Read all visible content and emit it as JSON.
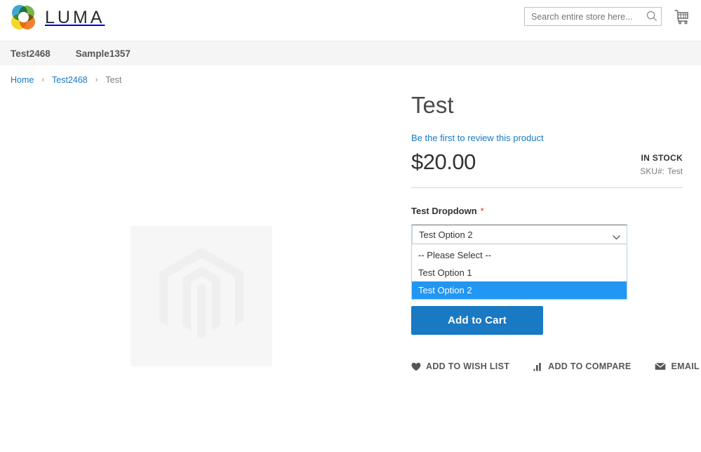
{
  "header": {
    "logo_text": "LUMA",
    "logo_icon": "luma-ring-logo",
    "search": {
      "placeholder": "Search entire store here...",
      "value": "",
      "icon": "search-icon"
    },
    "cart": {
      "icon": "shopping-cart-icon"
    }
  },
  "nav": {
    "items": [
      {
        "label": "Test2468"
      },
      {
        "label": "Sample1357"
      }
    ]
  },
  "breadcrumbs": {
    "separator": "›",
    "items": [
      {
        "label": "Home",
        "current": false
      },
      {
        "label": "Test2468",
        "current": false
      },
      {
        "label": "Test",
        "current": true
      }
    ]
  },
  "product": {
    "media": {
      "placeholder_icon": "magento-hexagon-placeholder"
    },
    "title": "Test",
    "review_link": "Be the first to review this product",
    "price": "$20.00",
    "stock_status": "IN STOCK",
    "sku_label": "SKU#:",
    "sku_value": "Test",
    "option": {
      "label": "Test Dropdown",
      "required_mark": "*",
      "selected_value": "Test Option 2",
      "chevron_icon": "chevron-down-icon",
      "options": [
        {
          "label": "-- Please Select --",
          "selected": false
        },
        {
          "label": "Test Option 1",
          "selected": false
        },
        {
          "label": "Test Option 2",
          "selected": true
        }
      ]
    },
    "add_to_cart_label": "Add to Cart",
    "social_links": [
      {
        "label": "ADD TO WISH LIST",
        "icon": "heart-icon"
      },
      {
        "label": "ADD TO COMPARE",
        "icon": "compare-bars-icon"
      },
      {
        "label": "EMAIL",
        "icon": "envelope-icon"
      }
    ]
  },
  "colors": {
    "accent_blue": "#1979c3",
    "link_blue": "#1979c3",
    "highlight_blue": "#2196f3",
    "required_red": "#e02b27",
    "nav_bg": "#f5f5f5",
    "media_bg": "#f6f6f6"
  }
}
